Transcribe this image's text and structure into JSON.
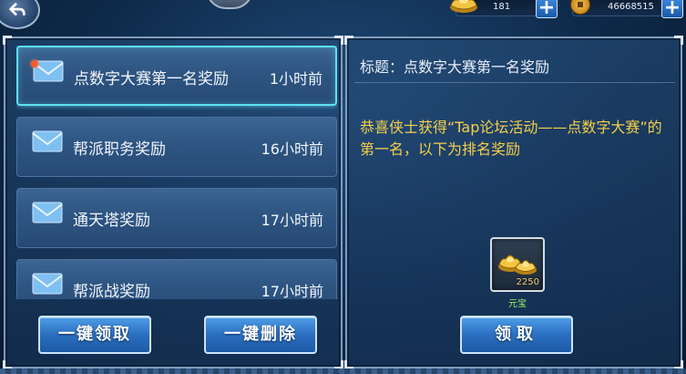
{
  "top_bar": {
    "ingot_count": "181",
    "coin_count": "46668515",
    "icons": [
      "back-arrow-icon",
      "gold-ingot-icon",
      "copper-coin-icon",
      "plus-icon"
    ]
  },
  "mail_list": [
    {
      "title": "点数字大赛第一名奖励",
      "time": "1小时前",
      "unread": true,
      "selected": true
    },
    {
      "title": "帮派职务奖励",
      "time": "16小时前",
      "unread": false,
      "selected": false
    },
    {
      "title": "通天塔奖励",
      "time": "17小时前",
      "unread": false,
      "selected": false
    },
    {
      "title": "帮派战奖励",
      "time": "17小时前",
      "unread": false,
      "selected": false
    }
  ],
  "left_buttons": {
    "claim_all": "一键领取",
    "delete_all": "一键删除"
  },
  "detail": {
    "title": "标题：点数字大赛第一名奖励",
    "body": "恭喜侠士获得“Tap论坛活动——点数字大赛”的第一名，以下为排名奖励",
    "reward": {
      "count": "2250",
      "name": "元宝"
    },
    "claim_button": "领取"
  },
  "colors": {
    "selected_border": "#5ee0f2",
    "body_text": "#f5cf4a",
    "reward_name": "#9ff06a",
    "unread_dot": "#ff5a2a"
  }
}
